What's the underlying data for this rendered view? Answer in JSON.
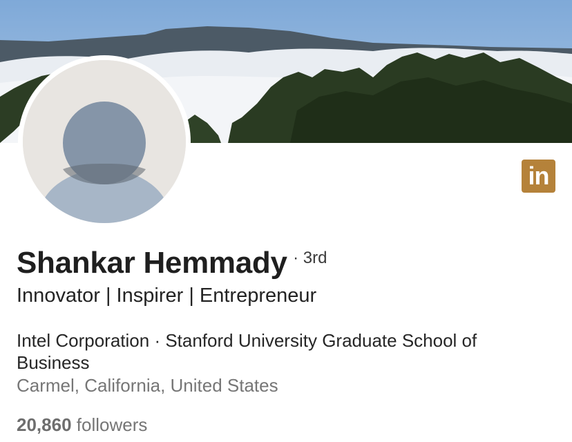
{
  "profile": {
    "name": "Shankar Hemmady",
    "degree": "· 3rd",
    "headline": "Innovator | Inspirer | Entrepreneur",
    "organizations": "Intel Corporation · Stanford University Graduate School of Business",
    "location": "Carmel, California, United States",
    "followers_count": "20,860",
    "followers_label": "followers"
  },
  "badge": {
    "text": "in",
    "icon": "linkedin-icon"
  },
  "colors": {
    "badge_bg": "#b5823a",
    "sky": "#8fb6dd",
    "avatar_bg": "#e8e5e1",
    "avatar_figure": "#9aabbe"
  }
}
